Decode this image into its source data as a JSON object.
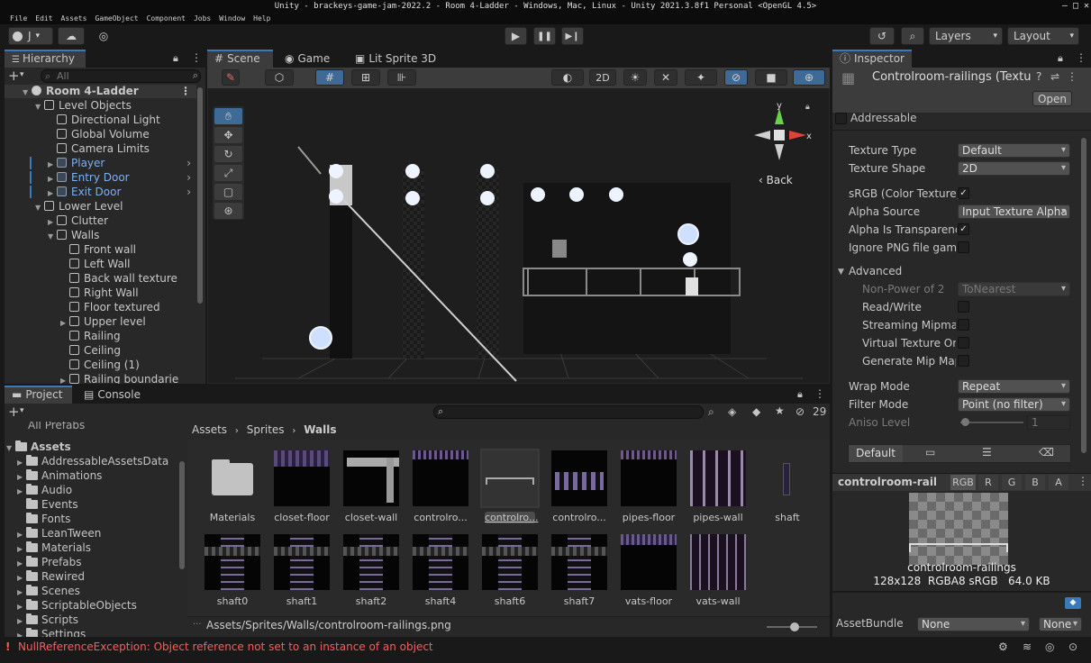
{
  "window": {
    "title": "Unity - brackeys-game-jam-2022.2 - Room 4-Ladder - Windows, Mac, Linux - Unity 2021.3.8f1 Personal <OpenGL 4.5>",
    "min": "—",
    "max": "□",
    "close": "✕"
  },
  "menu": [
    "File",
    "Edit",
    "Assets",
    "GameObject",
    "Component",
    "Jobs",
    "Window",
    "Help"
  ],
  "toolbar": {
    "account": "J",
    "layers": "Layers",
    "layout": "Layout"
  },
  "hierarchy": {
    "tab": "Hierarchy",
    "search_placeholder": "All",
    "rows": [
      {
        "label": "Room 4-Ladder",
        "depth": 0,
        "expanded": true,
        "blue": false,
        "scene": true
      },
      {
        "label": "Level Objects",
        "depth": 1,
        "expanded": true,
        "blue": false
      },
      {
        "label": "Directional Light",
        "depth": 2,
        "blue": false
      },
      {
        "label": "Global Volume",
        "depth": 2,
        "blue": false
      },
      {
        "label": "Camera Limits",
        "depth": 2,
        "blue": false
      },
      {
        "label": "Player",
        "depth": 2,
        "collapsed": true,
        "blue": true
      },
      {
        "label": "Entry Door",
        "depth": 2,
        "collapsed": true,
        "blue": true
      },
      {
        "label": "Exit Door",
        "depth": 2,
        "collapsed": true,
        "blue": true
      },
      {
        "label": "Lower Level",
        "depth": 1,
        "expanded": true,
        "blue": false
      },
      {
        "label": "Clutter",
        "depth": 2,
        "collapsed": true,
        "blue": false
      },
      {
        "label": "Walls",
        "depth": 2,
        "expanded": true,
        "blue": false
      },
      {
        "label": "Front wall",
        "depth": 3,
        "blue": false
      },
      {
        "label": "Left Wall",
        "depth": 3,
        "blue": false
      },
      {
        "label": "Back wall texture",
        "depth": 3,
        "blue": false
      },
      {
        "label": "Right Wall",
        "depth": 3,
        "blue": false
      },
      {
        "label": "Floor textured",
        "depth": 3,
        "blue": false
      },
      {
        "label": "Upper level",
        "depth": 3,
        "collapsed": true,
        "blue": false
      },
      {
        "label": "Railing",
        "depth": 3,
        "blue": false
      },
      {
        "label": "Ceiling",
        "depth": 3,
        "blue": false
      },
      {
        "label": "Ceiling (1)",
        "depth": 3,
        "blue": false
      },
      {
        "label": "Railing boundarie",
        "depth": 3,
        "collapsed": true,
        "blue": false
      }
    ]
  },
  "scene": {
    "tabs": [
      "Scene",
      "Game",
      "Lit Sprite 3D"
    ],
    "mode_2d": "2D",
    "gizmo_back": "Back",
    "axis_x": "x",
    "axis_y": "y"
  },
  "inspector": {
    "tab": "Inspector",
    "title": "Controlroom-railings (Textu",
    "open_btn": "Open",
    "addressable": "Addressable",
    "rows": {
      "texture_type": {
        "label": "Texture Type",
        "value": "Default"
      },
      "texture_shape": {
        "label": "Texture Shape",
        "value": "2D"
      },
      "srgb": {
        "label": "sRGB (Color Texture)",
        "checked": "✓"
      },
      "alpha_source": {
        "label": "Alpha Source",
        "value": "Input Texture Alpha"
      },
      "alpha_transp": {
        "label": "Alpha Is Transparenc",
        "checked": "✓"
      },
      "ignore_png": {
        "label": "Ignore PNG file gamm"
      },
      "advanced": "Advanced",
      "npot": {
        "label": "Non-Power of 2",
        "value": "ToNearest"
      },
      "readwrite": {
        "label": "Read/Write"
      },
      "streaming": {
        "label": "Streaming Mipmap"
      },
      "virtual": {
        "label": "Virtual Texture Onl"
      },
      "genmip": {
        "label": "Generate Mip Map"
      },
      "wrap": {
        "label": "Wrap Mode",
        "value": "Repeat"
      },
      "filter": {
        "label": "Filter Mode",
        "value": "Point (no filter)"
      },
      "aniso": {
        "label": "Aniso Level",
        "value": "1"
      }
    },
    "platform_default": "Default",
    "preview": {
      "name_bar": "controlroom-rail",
      "channels": [
        "RGB",
        "R",
        "G",
        "B",
        "A"
      ],
      "filename": "controlroom-railings",
      "info": "128x128  RGBA8 sRGB   64.0 KB"
    },
    "assetbundle": {
      "label": "AssetBundle",
      "value": "None",
      "variant": "None"
    }
  },
  "project": {
    "tabs": [
      "Project",
      "Console"
    ],
    "hidden_count": "29",
    "breadcrumb": [
      "Assets",
      "Sprites",
      "Walls"
    ],
    "partial_top": "All Prefabs",
    "root": "Assets",
    "tree": [
      {
        "label": "AddressableAssetsData",
        "arrow": true
      },
      {
        "label": "Animations",
        "arrow": true
      },
      {
        "label": "Audio",
        "arrow": true
      },
      {
        "label": "Events",
        "arrow": false
      },
      {
        "label": "Fonts",
        "arrow": false
      },
      {
        "label": "LeanTween",
        "arrow": true
      },
      {
        "label": "Materials",
        "arrow": true
      },
      {
        "label": "Prefabs",
        "arrow": true
      },
      {
        "label": "Rewired",
        "arrow": true
      },
      {
        "label": "Scenes",
        "arrow": true
      },
      {
        "label": "ScriptableObjects",
        "arrow": true
      },
      {
        "label": "Scripts",
        "arrow": true
      },
      {
        "label": "Settings",
        "arrow": true
      }
    ],
    "assets_row1": [
      "Materials",
      "closet-floor",
      "closet-wall",
      "controlro...",
      "controlro...",
      "controlro...",
      "pipes-floor",
      "pipes-wall",
      "shaft"
    ],
    "assets_row2": [
      "shaft0",
      "shaft1",
      "shaft2",
      "shaft4",
      "shaft6",
      "shaft7",
      "vats-floor",
      "vats-wall"
    ],
    "path": "Assets/Sprites/Walls/controlroom-railings.png"
  },
  "status": {
    "error": "NullReferenceException: Object reference not set to an instance of an object"
  },
  "colors": {
    "accent": "#3a79bb",
    "error": "#ff5a5a",
    "selected": "#2c5d87"
  }
}
